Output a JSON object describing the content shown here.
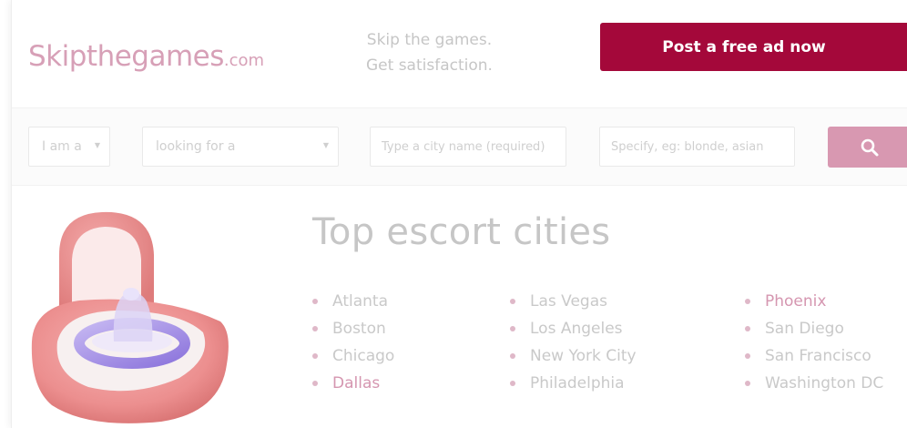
{
  "header": {
    "logo_main": "Skipthegames",
    "logo_suffix": ".com",
    "tagline_line1": "Skip the games.",
    "tagline_line2": "Get satisfaction.",
    "post_ad_label": "Post a free ad now"
  },
  "search": {
    "iam_value": "I am a",
    "looking_value": "looking for a",
    "city_placeholder": "Type a city name (required)",
    "specify_placeholder": "Specify, eg: blonde, asian"
  },
  "main": {
    "title": "Top escort cities",
    "cities": [
      [
        {
          "name": "Atlanta",
          "highlight": false
        },
        {
          "name": "Boston",
          "highlight": false
        },
        {
          "name": "Chicago",
          "highlight": false
        },
        {
          "name": "Dallas",
          "highlight": true
        }
      ],
      [
        {
          "name": "Las Vegas",
          "highlight": false
        },
        {
          "name": "Los Angeles",
          "highlight": false
        },
        {
          "name": "New York City",
          "highlight": false
        },
        {
          "name": "Philadelphia",
          "highlight": false
        }
      ],
      [
        {
          "name": "Phoenix",
          "highlight": true
        },
        {
          "name": "San Diego",
          "highlight": false
        },
        {
          "name": "San Francisco",
          "highlight": false
        },
        {
          "name": "Washington DC",
          "highlight": false
        }
      ]
    ]
  },
  "icons": {
    "search_button": "search-icon",
    "dropdown": "caret-down-icon"
  },
  "colors": {
    "brand": "#a4083a",
    "logo": "#d7a0b7",
    "search_button": "#d898b1",
    "highlight_link": "#d596b0",
    "muted_text": "#c6c6c6"
  }
}
